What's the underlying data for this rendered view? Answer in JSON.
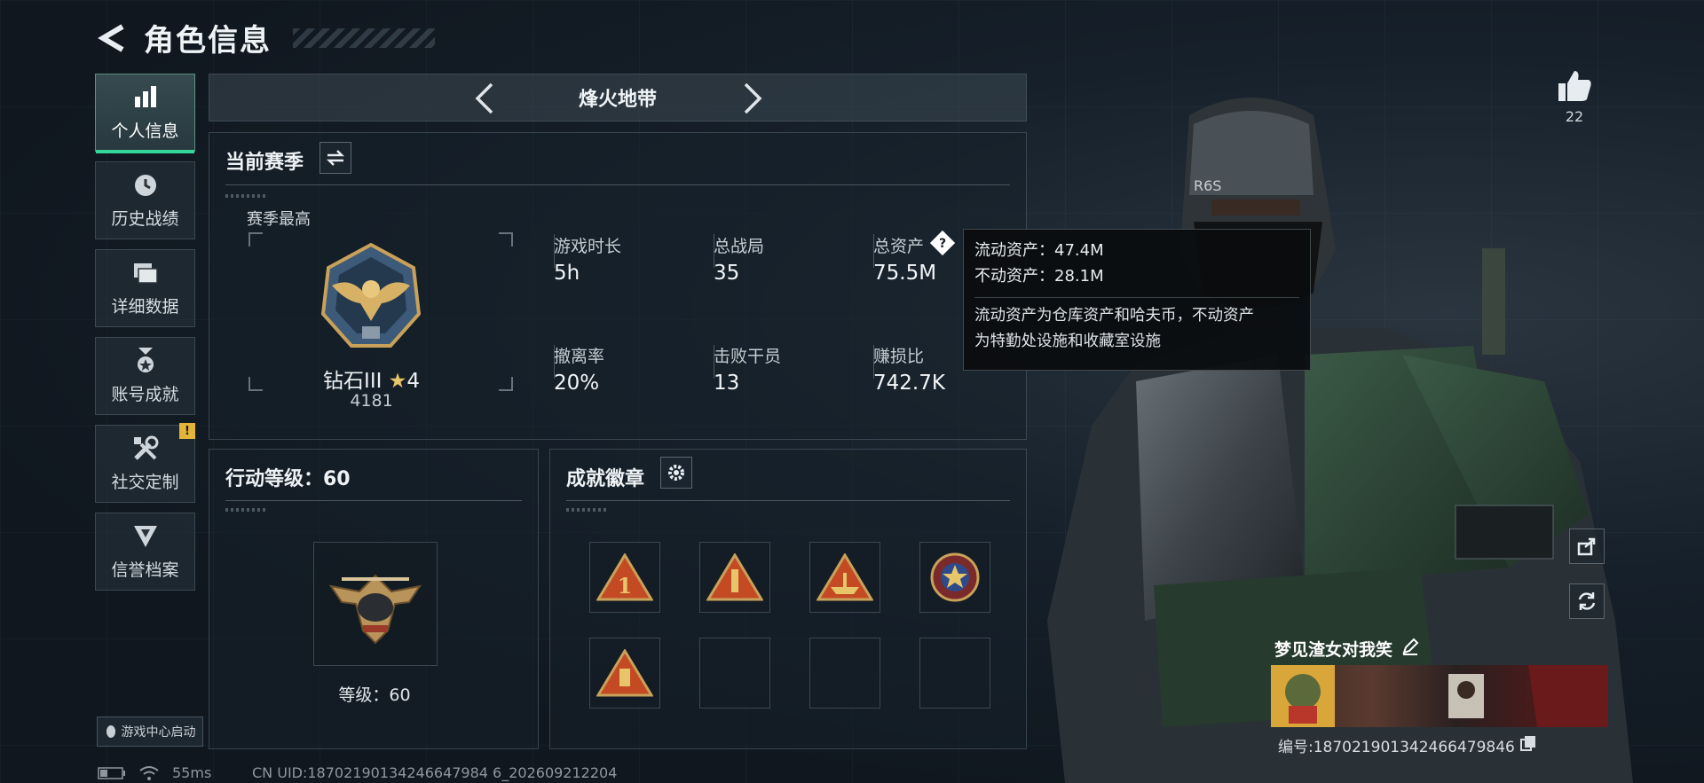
{
  "header": {
    "title": "角色信息"
  },
  "sidebar": {
    "items": [
      {
        "label": "个人信息",
        "icon": "bar-chart-icon",
        "active": true
      },
      {
        "label": "历史战绩",
        "icon": "clock-icon"
      },
      {
        "label": "详细数据",
        "icon": "folder-icon"
      },
      {
        "label": "账号成就",
        "icon": "medal-icon"
      },
      {
        "label": "社交定制",
        "icon": "tools-icon",
        "badge": "!"
      },
      {
        "label": "信誉档案",
        "icon": "shield-icon"
      }
    ],
    "launch_label": "游戏中心启动"
  },
  "mode": {
    "name": "烽火地带"
  },
  "season": {
    "title": "当前赛季",
    "best_label": "赛季最高",
    "rank_name": "钻石III",
    "rank_stars": "4",
    "rank_score": "4181"
  },
  "stats": [
    {
      "label": "游戏时长",
      "value": "5h"
    },
    {
      "label": "总战局",
      "value": "35"
    },
    {
      "label": "总资产",
      "value": "75.5M"
    },
    {
      "label": "撤离率",
      "value": "20%"
    },
    {
      "label": "击败干员",
      "value": "13"
    },
    {
      "label": "赚损比",
      "value": "742.7K"
    }
  ],
  "tooltip": {
    "line1": "流动资产：47.4M",
    "line2": "不动资产：28.1M",
    "desc1": "流动资产为仓库资产和哈夫币，不动资产",
    "desc2": "为特勤处设施和收藏室设施"
  },
  "action_level": {
    "title": "行动等级：60",
    "level_label": "等级：60"
  },
  "badges": {
    "title": "成就徽章"
  },
  "player": {
    "likes": "22",
    "name": "梦见渣女对我笑",
    "id": "编号:18702190134246647984‍6"
  },
  "status": {
    "ping": "55ms",
    "uid": "CN UID:18702190134246647984 6_202609212204"
  },
  "colors": {
    "accent_green": "#35d59a",
    "warn_yellow": "#e3b43a",
    "gold": "#c8a15a"
  }
}
